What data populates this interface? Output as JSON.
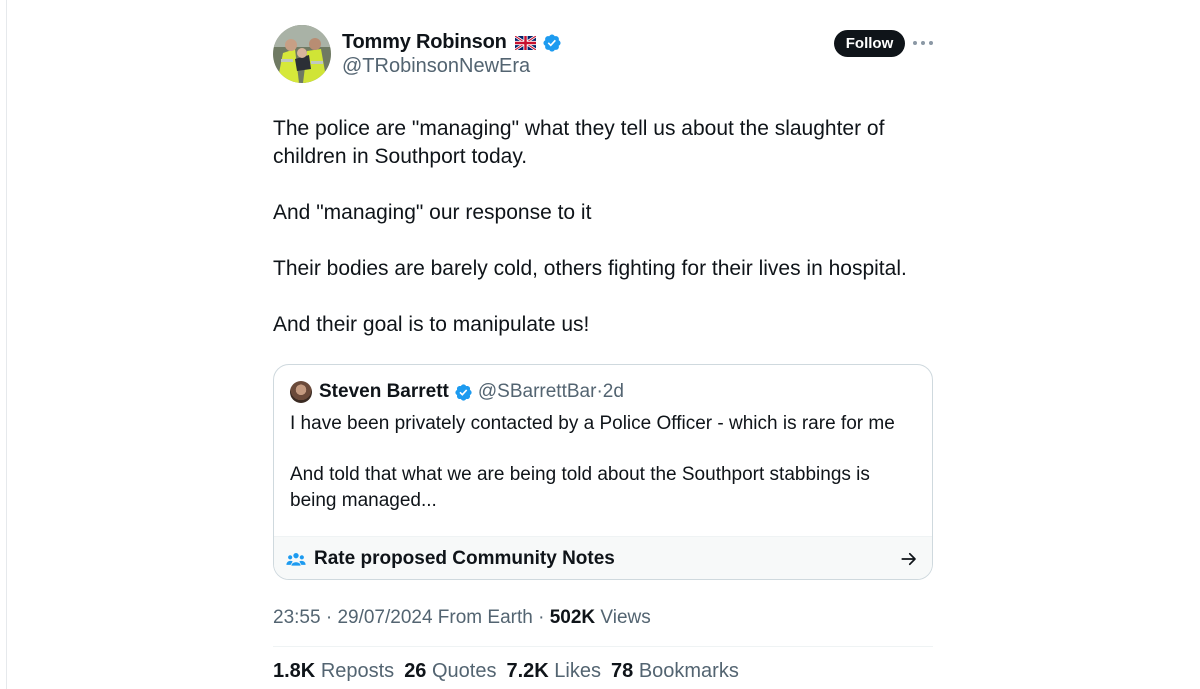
{
  "author": {
    "name": "Tommy Robinson",
    "handle": "@TRobinsonNewEra"
  },
  "follow_label": "Follow",
  "tweet_paragraphs": [
    "The police are \"managing\" what they tell us about the slaughter of children in Southport today.",
    "And \"managing\" our response to it",
    "Their bodies are barely cold, others fighting for their lives in hospital.",
    "And their goal is to manipulate us!"
  ],
  "quote": {
    "name": "Steven Barrett",
    "handle": "@SBarrettBar",
    "separator": "·",
    "age": "2d",
    "paragraphs": [
      "I have been privately contacted by a Police Officer - which is rare for me",
      "And told that what we are being told about the Southport stabbings is being managed..."
    ]
  },
  "community_notes_label": "Rate proposed Community Notes",
  "meta": {
    "time": "23:55",
    "sep1": " · ",
    "date": "29/07/2024",
    "source": " From Earth",
    "sep2": " · ",
    "views_count": "502K",
    "views_label": " Views"
  },
  "stats": {
    "reposts_count": "1.8K",
    "reposts_label": "Reposts",
    "quotes_count": "26",
    "quotes_label": "Quotes",
    "likes_count": "7.2K",
    "likes_label": "Likes",
    "bookmarks_count": "78",
    "bookmarks_label": "Bookmarks"
  },
  "colors": {
    "verified": "#1d9bf0",
    "secondary_text": "#536471",
    "follow_bg": "#0f1419",
    "notes_icon": "#1d9bf0"
  },
  "icons": [
    "uk-flag-icon",
    "verified-badge-icon",
    "more-icon",
    "community-notes-icon",
    "arrow-right-icon"
  ]
}
